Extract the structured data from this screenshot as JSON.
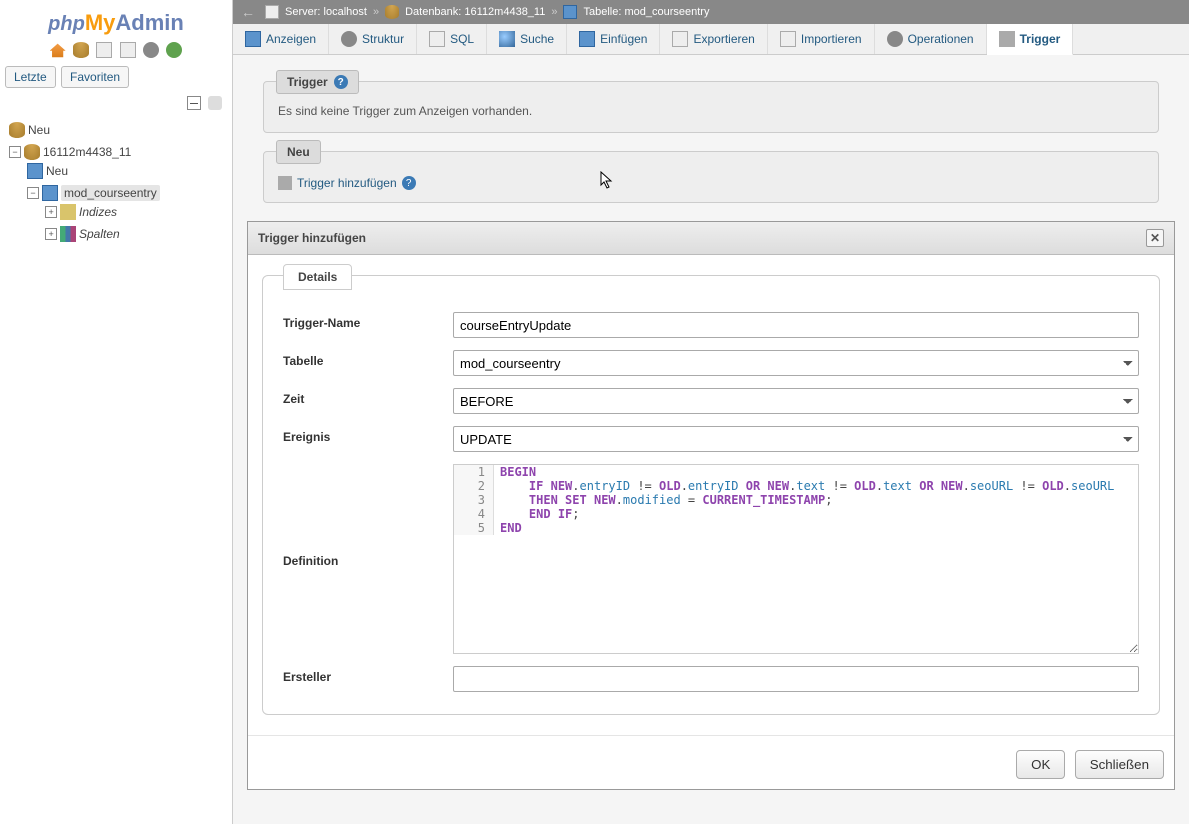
{
  "logo": {
    "php": "php",
    "my": "My",
    "admin": "Admin"
  },
  "sidebar": {
    "tabs": {
      "recent": "Letzte",
      "favorites": "Favoriten"
    },
    "tree": {
      "new_top": "Neu",
      "db": "16112m4438_11",
      "new_db": "Neu",
      "table": "mod_courseentry",
      "indexes": "Indizes",
      "columns": "Spalten"
    }
  },
  "breadcrumb": {
    "server_label": "Server:",
    "server_value": "localhost",
    "db_label": "Datenbank:",
    "db_value": "16112m4438_11",
    "table_label": "Tabelle:",
    "table_value": "mod_courseentry"
  },
  "tabs": {
    "browse": "Anzeigen",
    "structure": "Struktur",
    "sql": "SQL",
    "search": "Suche",
    "insert": "Einfügen",
    "export": "Exportieren",
    "import": "Importieren",
    "operations": "Operationen",
    "triggers": "Trigger"
  },
  "panel_trigger": {
    "legend": "Trigger",
    "empty": "Es sind keine Trigger zum Anzeigen vorhanden."
  },
  "panel_new": {
    "legend": "Neu",
    "add": "Trigger hinzufügen"
  },
  "dialog": {
    "title": "Trigger hinzufügen",
    "details": "Details",
    "labels": {
      "name": "Trigger-Name",
      "table": "Tabelle",
      "time": "Zeit",
      "event": "Ereignis",
      "definition": "Definition",
      "definer": "Ersteller"
    },
    "values": {
      "name": "courseEntryUpdate",
      "table": "mod_courseentry",
      "time": "BEFORE",
      "event": "UPDATE",
      "definer": ""
    },
    "code": [
      {
        "n": "1",
        "t": "BEGIN",
        "cls": "kw"
      },
      {
        "n": "2",
        "html": "    <span class='kw'>IF</span> <span class='kw'>NEW</span>.<span class='id'>entryID</span> != <span class='kw'>OLD</span>.<span class='id'>entryID</span> <span class='kw'>OR</span> <span class='kw'>NEW</span>.<span class='id'>text</span> != <span class='kw'>OLD</span>.<span class='id'>text</span> <span class='kw'>OR</span> <span class='kw'>NEW</span>.<span class='id'>seoURL</span> != <span class='kw'>OLD</span>.<span class='id'>seoURL</span>"
      },
      {
        "n": "3",
        "html": "    <span class='kw'>THEN</span> <span class='kw'>SET</span> <span class='kw'>NEW</span>.<span class='id'>modified</span> = <span class='kw'>CURRENT_TIMESTAMP</span>;"
      },
      {
        "n": "4",
        "html": "    <span class='kw'>END</span> <span class='kw'>IF</span>;"
      },
      {
        "n": "5",
        "t": "END",
        "cls": "kw"
      }
    ],
    "buttons": {
      "ok": "OK",
      "close": "Schließen"
    }
  }
}
